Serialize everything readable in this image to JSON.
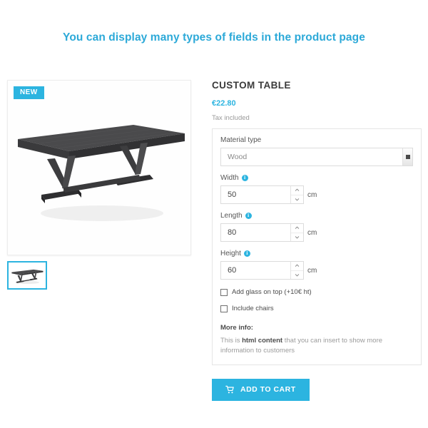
{
  "heading": "You can display many types of fields in the product page",
  "gallery": {
    "badge": "NEW",
    "main_image_alt": "Dark grey wooden trestle dining table",
    "thumb_alt": "Dark grey wooden trestle dining table thumbnail"
  },
  "product": {
    "title": "CUSTOM TABLE",
    "price": "€22.80",
    "tax_note": "Tax included"
  },
  "fields": {
    "material": {
      "label": "Material type",
      "value": "Wood",
      "options": [
        "Wood"
      ]
    },
    "width": {
      "label": "Width",
      "value": "50",
      "unit": "cm",
      "info": "i"
    },
    "length": {
      "label": "Length",
      "value": "80",
      "unit": "cm",
      "info": "i"
    },
    "height": {
      "label": "Height",
      "value": "60",
      "unit": "cm",
      "info": "i"
    },
    "glass_checkbox": "Add glass on top (+10€ ht)",
    "chairs_checkbox": "Include chairs",
    "more_info_title": "More info:",
    "more_info_prefix": "This is ",
    "more_info_bold": "html content",
    "more_info_suffix": " that you can insert to show more information to customers"
  },
  "actions": {
    "add_to_cart": "ADD TO CART",
    "cart_icon": "shopping-cart-icon"
  },
  "colors": {
    "accent": "#2cb4e0",
    "heading": "#2ca9d8",
    "text": "#4c4c4c",
    "muted": "#9b9b9b",
    "border": "#e5e5e5"
  }
}
